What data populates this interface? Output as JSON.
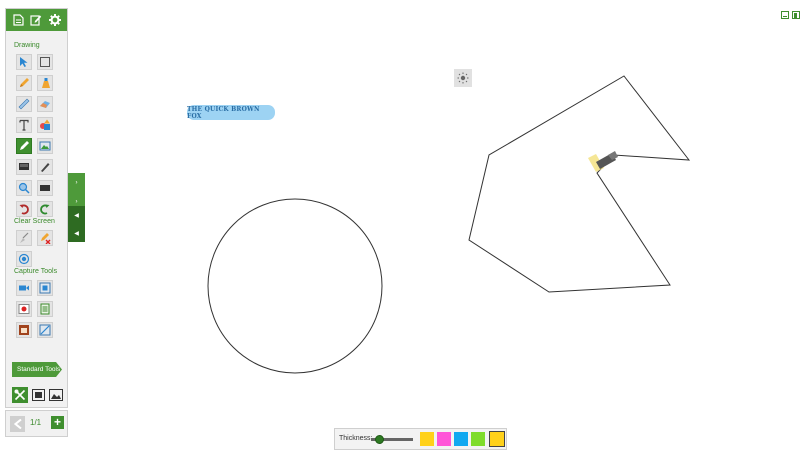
{
  "toolbar": {
    "sections": {
      "drawing": "Drawing",
      "clear_screen": "Clear Screen",
      "capture_tools": "Capture Tools"
    },
    "standard_tools_label": "Standard Tools"
  },
  "pager": {
    "count": "1/1",
    "add_label": "+"
  },
  "canvas": {
    "text_annotation": "THE QUICK BROWN FOX"
  },
  "properties": {
    "thickness_label": "Thickness:",
    "colors": [
      "#ffd11a",
      "#ff55d8",
      "#11a8f0",
      "#7fdc2b",
      "#ffd11a"
    ]
  },
  "theme": {
    "accent": "#4e9a3a",
    "accent_dark": "#2e6b22"
  }
}
